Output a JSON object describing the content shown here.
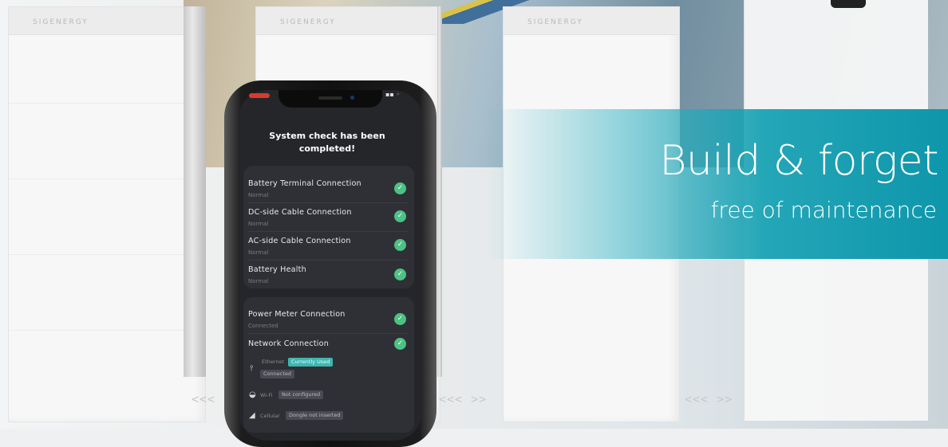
{
  "units": [
    {
      "brand": "SIGENERGY"
    },
    {
      "brand": "SIGENERGY"
    },
    {
      "brand": "SIGENERGY"
    }
  ],
  "chevrons": {
    "left": "<<<",
    "mid": "<<< >>",
    "right": "<<< >>"
  },
  "banner": {
    "headline": "Build & forget",
    "subline": "free of maintenance",
    "color": "#0e96ab"
  },
  "phone": {
    "title_line1": "System check has been",
    "title_line2": "completed!",
    "checks": [
      {
        "name": "Battery Terminal Connection",
        "status": "Normal"
      },
      {
        "name": "DC-side Cable Connection",
        "status": "Normal"
      },
      {
        "name": "AC-side Cable Connection",
        "status": "Normal"
      },
      {
        "name": "Battery Health",
        "status": "Normal"
      }
    ],
    "connections": [
      {
        "name": "Power Meter Connection",
        "status": "Connected"
      },
      {
        "name": "Network Connection",
        "status": ""
      }
    ],
    "network": {
      "ethernet_label": "Ethernet",
      "ethernet_tag": "Currently Used",
      "ethernet_status": "Connected",
      "wifi_label": "Wi-Fi",
      "wifi_status": "Not configured",
      "cellular_label": "Cellular",
      "cellular_status": "Dongle not inserted"
    },
    "check_color": "#4cc285"
  }
}
